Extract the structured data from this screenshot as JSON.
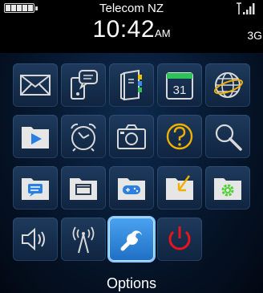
{
  "status_bar": {
    "carrier": "Telecom NZ",
    "time": "10:42",
    "ampm": "AM",
    "network": "3G"
  },
  "apps": [
    {
      "name": "messages",
      "icon": "envelope-icon"
    },
    {
      "name": "text-messages",
      "icon": "phone-chat-icon"
    },
    {
      "name": "contacts",
      "icon": "address-book-icon"
    },
    {
      "name": "calendar",
      "icon": "calendar-icon",
      "day": "31"
    },
    {
      "name": "browser",
      "icon": "globe-icon"
    },
    {
      "name": "media",
      "icon": "media-folder-icon"
    },
    {
      "name": "clock",
      "icon": "alarm-clock-icon"
    },
    {
      "name": "camera",
      "icon": "camera-icon"
    },
    {
      "name": "help",
      "icon": "question-icon"
    },
    {
      "name": "search",
      "icon": "magnifier-icon"
    },
    {
      "name": "instant-messaging",
      "icon": "chat-folder-icon"
    },
    {
      "name": "applications",
      "icon": "window-folder-icon"
    },
    {
      "name": "games",
      "icon": "gamepad-folder-icon"
    },
    {
      "name": "downloads",
      "icon": "download-folder-icon"
    },
    {
      "name": "setup",
      "icon": "gear-folder-icon"
    },
    {
      "name": "sounds",
      "icon": "speaker-icon"
    },
    {
      "name": "manage-connections",
      "icon": "antenna-icon"
    },
    {
      "name": "options",
      "icon": "wrench-icon",
      "selected": true
    },
    {
      "name": "power",
      "icon": "power-icon"
    }
  ],
  "selected_label": "Options",
  "colors": {
    "selected_tile": "#3a8fe0",
    "power_red": "#e8141b",
    "calendar_green": "#2ec35a",
    "download_arrow": "#f0b000",
    "setup_gear": "#4dd02e"
  }
}
